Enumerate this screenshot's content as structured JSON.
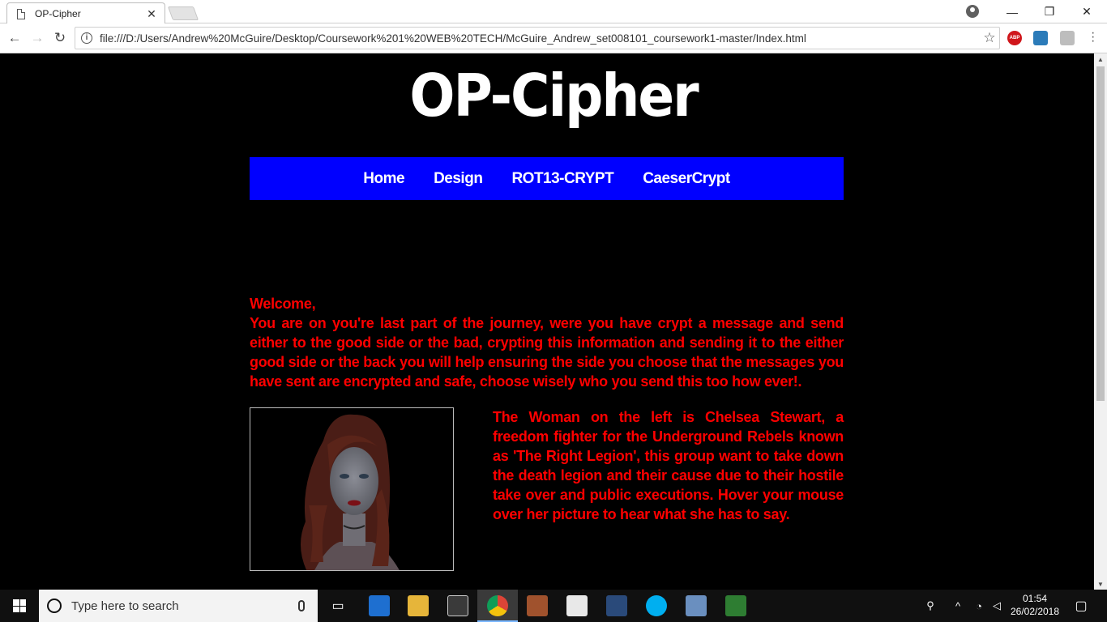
{
  "browser": {
    "tab_title": "OP-Cipher",
    "url": "file:///D:/Users/Andrew%20McGuire/Desktop/Coursework%201%20WEB%20TECH/McGuire_Andrew_set008101_coursework1-master/Index.html",
    "extensions": [
      "ABP"
    ]
  },
  "page": {
    "title": "OP-Cipher",
    "nav": [
      "Home",
      "Design",
      "ROT13-CRYPT",
      "CaeserCrypt"
    ],
    "welcome": "Welcome,",
    "intro": "You are on you're last part of the journey, were you have crypt a message and send either to the good side or the bad, crypting this information and sending it to the either good side or the back you will help ensuring the side you choose that the messages you have sent are encrypted and safe, choose wisely who you send this too how ever!.",
    "bio": "The Woman on the left is Chelsea Stewart, a freedom fighter for the Underground Rebels known as 'The Right Legion', this group want to take down the death legion and their cause due to their hostile take over and public executions. Hover your mouse over her picture to hear what she has to say."
  },
  "taskbar": {
    "search_placeholder": "Type here to search",
    "time": "01:54",
    "date": "26/02/2018"
  },
  "colors": {
    "nav_bg": "#0000ff",
    "text_red": "#ff0000"
  }
}
